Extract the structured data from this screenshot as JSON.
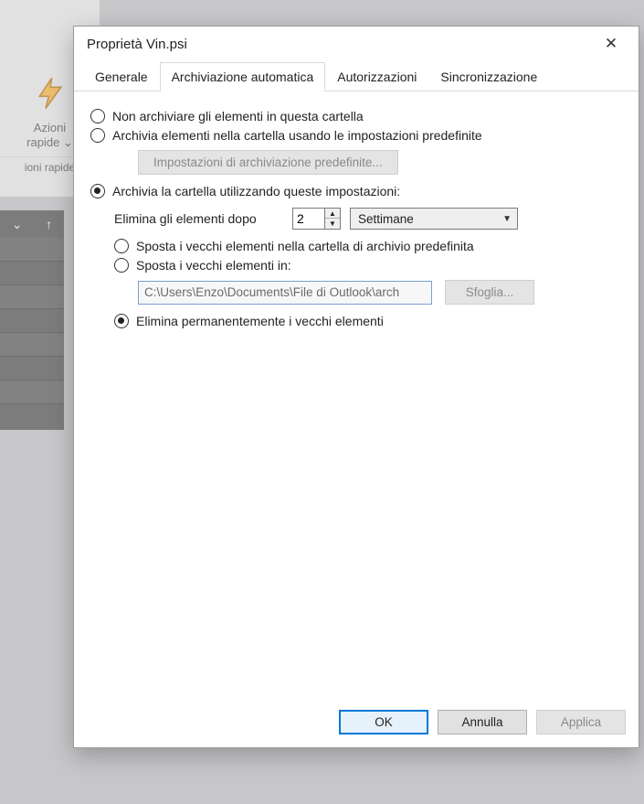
{
  "backdrop": {
    "ribbon_label_line1": "Azioni",
    "ribbon_label_line2": "rapide",
    "ribbon_sub": "ioni rapide",
    "sidebar_caret": "⌄",
    "sidebar_arrow": "↑"
  },
  "dialog": {
    "title": "Proprietà Vin.psi"
  },
  "tabs": {
    "general": "Generale",
    "autoarchive": "Archiviazione automatica",
    "permissions": "Autorizzazioni",
    "sync": "Sincronizzazione"
  },
  "options": {
    "dont_archive": "Non archiviare gli elementi in questa cartella",
    "use_default": "Archivia elementi nella cartella usando le impostazioni predefinite",
    "default_settings_btn": "Impostazioni di archiviazione predefinite...",
    "use_custom": "Archivia la cartella utilizzando queste impostazioni:",
    "clean_after_label": "Elimina gli elementi dopo",
    "clean_after_value": "2",
    "clean_after_unit": "Settimane",
    "move_default": "Sposta i vecchi elementi nella cartella di archivio predefinita",
    "move_to": "Sposta i vecchi elementi in:",
    "move_to_path": "C:\\Users\\Enzo\\Documents\\File di Outlook\\arch",
    "browse": "Sfoglia...",
    "delete_permanently": "Elimina permanentemente i vecchi elementi"
  },
  "footer": {
    "ok": "OK",
    "cancel": "Annulla",
    "apply": "Applica"
  }
}
